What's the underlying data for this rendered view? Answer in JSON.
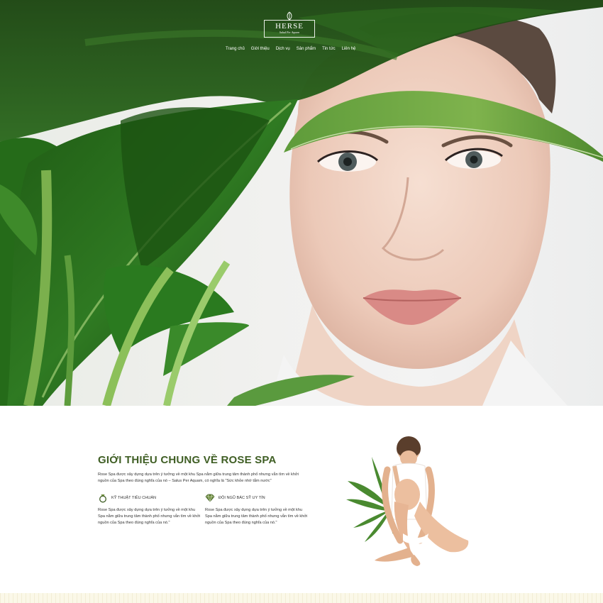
{
  "brand": {
    "name": "HERSE",
    "tagline": "Salud Per Aquam"
  },
  "nav": {
    "items": [
      "Trang chủ",
      "Giới thiệu",
      "Dịch vụ",
      "Sản phẩm",
      "Tin tức",
      "Liên hệ"
    ]
  },
  "about": {
    "title": "GIỚI THIỆU CHUNG VỀ ROSE SPA",
    "intro": "Rose Spa được xây dựng dựa trên ý tưởng về một khu Spa nằm giữa trung tâm thành phố nhưng vẫn tìm về khởi nguồn của Spa theo đúng nghĩa của nó – Salus Per Aquam, có nghĩa là \"Sức khỏe nhờ tắm nước\"",
    "features": [
      {
        "icon": "ring-icon",
        "label": "KỸ THUẬT TIÊU CHUẨN",
        "text": "Rose Spa được xây dựng dựa trên ý tưởng về một khu Spa nằm giữa trung tâm thành phố nhưng vẫn tìm về khởi nguồn của Spa theo đúng nghĩa của nó.\""
      },
      {
        "icon": "diamond-icon",
        "label": "ĐỘI NGŨ BÁC SỸ UY TÍN",
        "text": "Rose Spa được xây dựng dựa trên ý tưởng về một khu Spa nằm giữa trung tâm thành phố nhưng vẫn tìm về khởi nguồn của Spa theo đúng nghĩa của nó.\""
      }
    ]
  },
  "colors": {
    "accent_green": "#3f5e24",
    "leaf_green": "#3f8a2c",
    "footer_strip": "#fbf8e8"
  }
}
